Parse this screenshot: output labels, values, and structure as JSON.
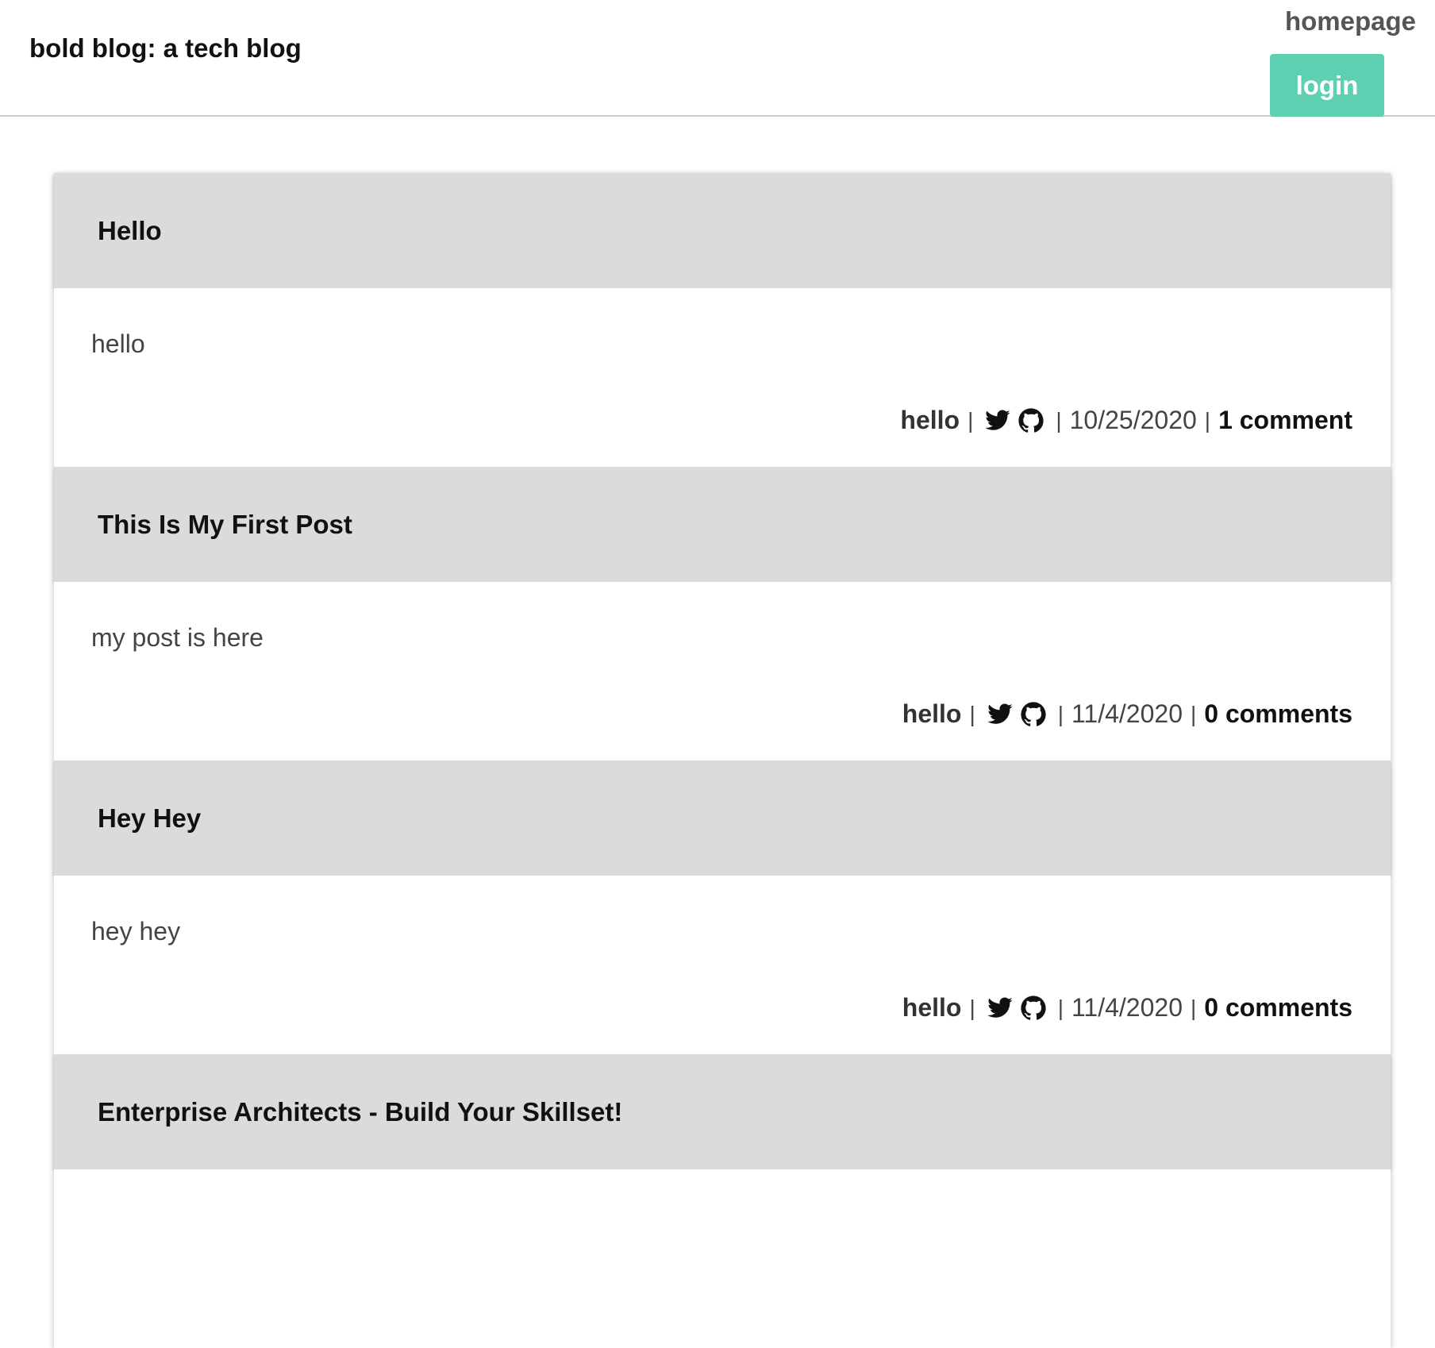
{
  "header": {
    "brand": "bold blog: a tech blog",
    "nav_home": "homepage",
    "login_label": "login"
  },
  "posts": [
    {
      "title": "Hello",
      "content": "hello",
      "author": "hello",
      "date": "10/25/2020",
      "comments": "1 comment"
    },
    {
      "title": "This Is My First Post",
      "content": "my post is here",
      "author": "hello",
      "date": "11/4/2020",
      "comments": "0 comments"
    },
    {
      "title": "Hey Hey",
      "content": "hey hey",
      "author": "hello",
      "date": "11/4/2020",
      "comments": "0 comments"
    },
    {
      "title": "Enterprise Architects - Build Your Skillset!"
    }
  ],
  "meta": {
    "separator": "|"
  },
  "icons": {
    "twitter": "twitter-icon",
    "github": "github-icon"
  },
  "colors": {
    "accent": "#5ecfb1",
    "post_header_bg": "#dbdbdb"
  }
}
